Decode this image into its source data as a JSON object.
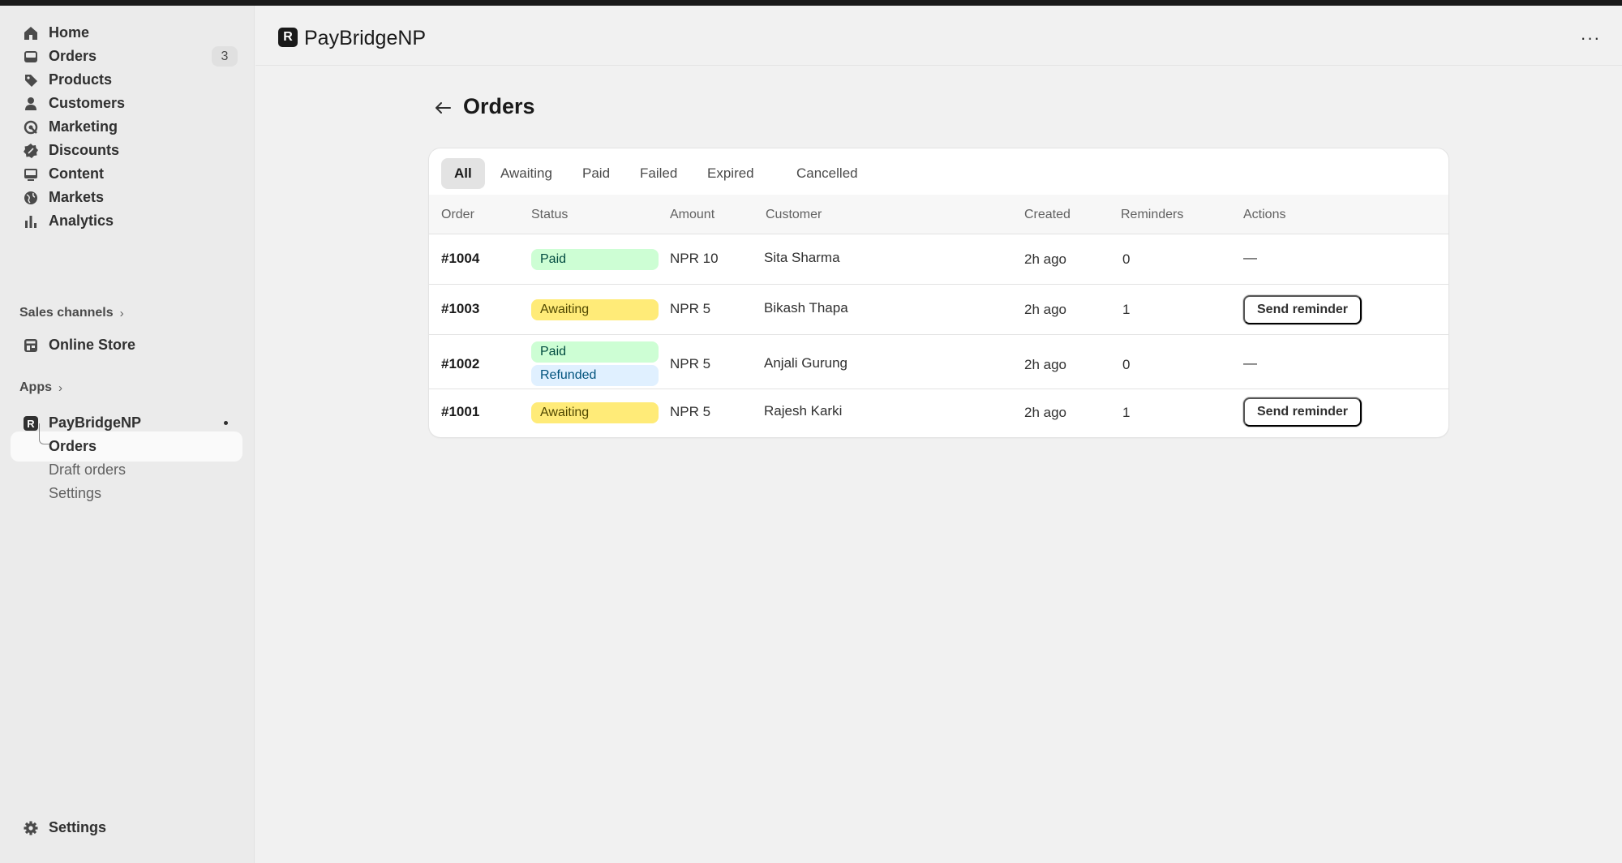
{
  "sidebar": {
    "items": [
      {
        "label": "Home",
        "icon": "home-icon"
      },
      {
        "label": "Orders",
        "icon": "inbox-icon",
        "badge": "3"
      },
      {
        "label": "Products",
        "icon": "tag-icon"
      },
      {
        "label": "Customers",
        "icon": "person-icon"
      },
      {
        "label": "Marketing",
        "icon": "target-icon"
      },
      {
        "label": "Discounts",
        "icon": "discount-icon"
      },
      {
        "label": "Content",
        "icon": "image-icon"
      },
      {
        "label": "Markets",
        "icon": "globe-icon"
      },
      {
        "label": "Analytics",
        "icon": "bar-chart-icon"
      }
    ],
    "sales_channels": {
      "label": "Sales channels",
      "chevron": "›"
    },
    "online_store": {
      "label": "Online Store",
      "icon": "store-icon"
    },
    "apps": {
      "label": "Apps",
      "chevron": "›"
    },
    "app": {
      "label": "PayBridgeNP",
      "icon_letter": "R"
    },
    "app_sub": [
      {
        "label": "Orders",
        "active": true
      },
      {
        "label": "Draft orders"
      },
      {
        "label": "Settings"
      }
    ],
    "settings": {
      "label": "Settings",
      "icon": "gear-icon"
    }
  },
  "header": {
    "app_logo_letter": "R",
    "app_title": "PayBridgeNP",
    "more": "···"
  },
  "page": {
    "back_icon": "arrow-left-icon",
    "title": "Orders"
  },
  "tabs": [
    {
      "label": "All",
      "active": true
    },
    {
      "label": "Awaiting"
    },
    {
      "label": "Paid"
    },
    {
      "label": "Failed"
    },
    {
      "label": "Expired"
    },
    {
      "label": "Cancelled"
    }
  ],
  "table": {
    "columns": [
      "Order",
      "Status",
      "Amount",
      "Customer",
      "Created",
      "Reminders",
      "Actions"
    ],
    "rows": [
      {
        "order": "#1004",
        "status": [
          "Paid"
        ],
        "amount": "NPR 10",
        "customer": "Sita Sharma",
        "created": "2h ago",
        "reminders": "0",
        "action": "—"
      },
      {
        "order": "#1003",
        "status": [
          "Awaiting"
        ],
        "amount": "NPR 5",
        "customer": "Bikash Thapa",
        "created": "2h ago",
        "reminders": "1",
        "action": "Send reminder"
      },
      {
        "order": "#1002",
        "status": [
          "Paid",
          "Refunded"
        ],
        "amount": "NPR 5",
        "customer": "Anjali Gurung",
        "created": "2h ago",
        "reminders": "0",
        "action": "—"
      },
      {
        "order": "#1001",
        "status": [
          "Awaiting"
        ],
        "amount": "NPR 5",
        "customer": "Rajesh Karki",
        "created": "2h ago",
        "reminders": "1",
        "action": "Send reminder"
      }
    ]
  },
  "colors": {
    "paid_bg": "#cdfed4",
    "awaiting_bg": "#ffeb78",
    "refunded_bg": "#e0f0ff"
  }
}
